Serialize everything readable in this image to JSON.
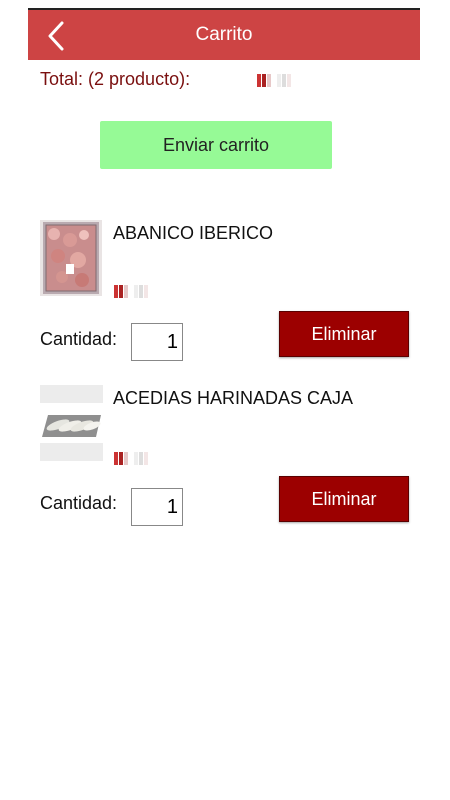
{
  "header": {
    "title": "Carrito",
    "color": "#cd4444"
  },
  "summary": {
    "total_label": "Total: (2 producto):"
  },
  "actions": {
    "send_cart_label": "Enviar carrito",
    "send_cart_color": "#96fa96"
  },
  "products": [
    {
      "name": "ABANICO IBERICO",
      "quantity_label": "Cantidad:",
      "quantity": "1",
      "delete_label": "Eliminar"
    },
    {
      "name": "ACEDIAS HARINADAS CAJA",
      "quantity_label": "Cantidad:",
      "quantity": "1",
      "delete_label": "Eliminar"
    }
  ],
  "icons": {
    "back": "chevron-left-icon"
  },
  "colors": {
    "delete_button": "#9c0000",
    "total_text": "#7a0f0f"
  }
}
